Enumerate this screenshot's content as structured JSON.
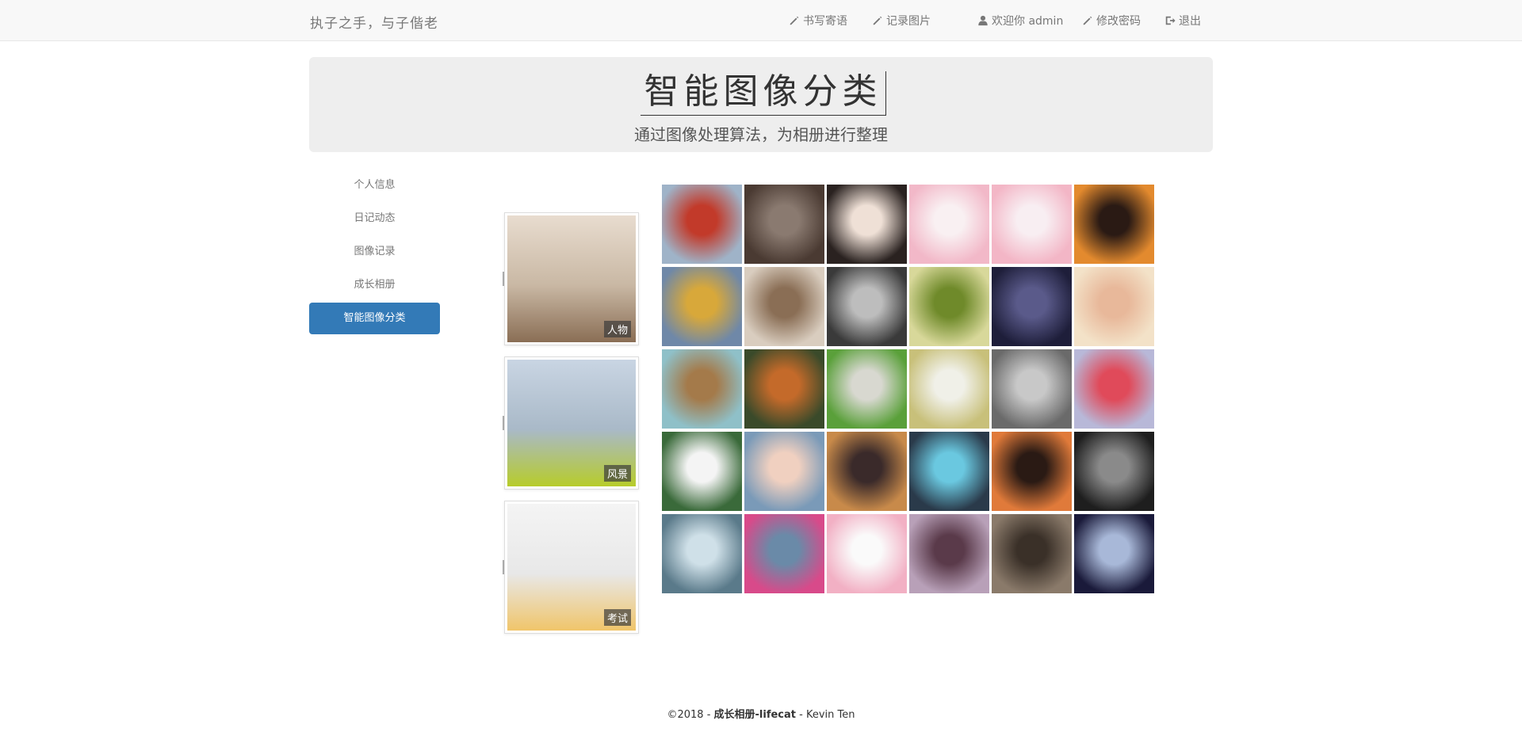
{
  "navbar": {
    "brand": "执子之手，与子偕老",
    "links": [
      {
        "label": "书写寄语",
        "icon": "pencil-icon"
      },
      {
        "label": "记录图片",
        "icon": "pencil-icon"
      },
      {
        "label": "欢迎你 admin",
        "icon": "user-icon"
      },
      {
        "label": "修改密码",
        "icon": "pencil-icon"
      },
      {
        "label": "退出",
        "icon": "logout-icon"
      }
    ]
  },
  "jumbotron": {
    "title": "智能图像分类",
    "subtitle": "通过图像处理算法，为相册进行整理"
  },
  "sidebar": {
    "items": [
      {
        "label": "个人信息",
        "active": false
      },
      {
        "label": "日记动态",
        "active": false
      },
      {
        "label": "图像记录",
        "active": false
      },
      {
        "label": "成长相册",
        "active": false
      },
      {
        "label": "智能图像分类",
        "active": true
      }
    ]
  },
  "categories": [
    {
      "label": "人物",
      "colors": [
        "#e8dccf",
        "#c9b8a4",
        "#8a6e55"
      ]
    },
    {
      "label": "风景",
      "colors": [
        "#c9d5e3",
        "#a9b9c8",
        "#b7cc2a"
      ]
    },
    {
      "label": "考试",
      "colors": [
        "#f4f4f4",
        "#e8e8e8",
        "#f0c56a"
      ]
    }
  ],
  "gallery": {
    "thumbnails": [
      {
        "colors": [
          "#9fb3c8",
          "#c23a2a"
        ]
      },
      {
        "colors": [
          "#4a3a32",
          "#8a7a70"
        ]
      },
      {
        "colors": [
          "#2a2220",
          "#efe0d6"
        ]
      },
      {
        "colors": [
          "#f2b8c8",
          "#f9f0f2"
        ]
      },
      {
        "colors": [
          "#f3b6c6",
          "#f8eef2"
        ]
      },
      {
        "colors": [
          "#e38a2e",
          "#2a1a14"
        ]
      },
      {
        "colors": [
          "#6f88a8",
          "#d8a83a"
        ]
      },
      {
        "colors": [
          "#d9cdbf",
          "#8a6e55"
        ]
      },
      {
        "colors": [
          "#3a3a3a",
          "#bdbdbd"
        ]
      },
      {
        "colors": [
          "#d8d89a",
          "#6f8a2a"
        ]
      },
      {
        "colors": [
          "#1e1e3a",
          "#5a5a8a"
        ]
      },
      {
        "colors": [
          "#f3e2c8",
          "#e8b89a"
        ]
      },
      {
        "colors": [
          "#8fc0c8",
          "#a47a4a"
        ]
      },
      {
        "colors": [
          "#3a4a2a",
          "#c46a2a"
        ]
      },
      {
        "colors": [
          "#5aa03a",
          "#d8d8d0"
        ]
      },
      {
        "colors": [
          "#c8c07a",
          "#f0f0e8"
        ]
      },
      {
        "colors": [
          "#6a6a6a",
          "#c8c8c8"
        ]
      },
      {
        "colors": [
          "#b8b8d8",
          "#e04a5a"
        ]
      },
      {
        "colors": [
          "#3a6a3a",
          "#f4f4f4"
        ]
      },
      {
        "colors": [
          "#7a9ab8",
          "#f0d0c0"
        ]
      },
      {
        "colors": [
          "#c88a4a",
          "#3a2a2a"
        ]
      },
      {
        "colors": [
          "#2a3a4a",
          "#6ac8e0"
        ]
      },
      {
        "colors": [
          "#e07a3a",
          "#2a1a14"
        ]
      },
      {
        "colors": [
          "#1e1e1e",
          "#8a8a8a"
        ]
      },
      {
        "colors": [
          "#5a7a8a",
          "#cfe0e8"
        ]
      },
      {
        "colors": [
          "#d84a8a",
          "#6a8aa8"
        ]
      },
      {
        "colors": [
          "#f2b0c4",
          "#fafafa"
        ]
      },
      {
        "colors": [
          "#b8a0b8",
          "#5a3a4a"
        ]
      },
      {
        "colors": [
          "#8a7a6a",
          "#3a3028"
        ]
      },
      {
        "colors": [
          "#1a1a3a",
          "#a8b8d8"
        ]
      }
    ]
  },
  "footer": {
    "year": "©2018 - ",
    "site": "成长相册-lifecat",
    "author": " - Kevin Ten"
  }
}
